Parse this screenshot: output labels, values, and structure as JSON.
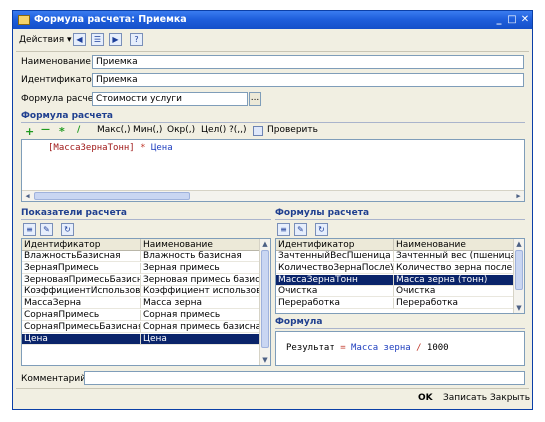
{
  "window": {
    "title": "Формула расчета: Приемка",
    "controls": [
      "_",
      "□",
      "✕"
    ]
  },
  "toolbar": {
    "actions_label": "Действия ▾",
    "icons": [
      "back-arrow-icon",
      "list-icon",
      "forward-icon",
      "help-icon"
    ],
    "help_glyph": "?"
  },
  "form": {
    "name_label": "Наименование:",
    "name_value": "Приемка",
    "id_label": "Идентификатор:",
    "id_value": "Приемка",
    "formula_label": "Формула расчета:",
    "formula_value": "Стоимости услуги",
    "ellipsis": "..."
  },
  "formula_section": {
    "title": "Формула расчета",
    "ops": [
      "+",
      "—",
      "*",
      "/"
    ],
    "funcs": [
      "Макс(,)",
      "Мин(,)",
      "Окр(,)",
      "Цел()",
      "?(,,)"
    ],
    "check_label": "Проверить",
    "expr_var": "[МассаЗернаТонн]",
    "expr_op": "*",
    "expr_var2": "Цена"
  },
  "indicators": {
    "title": "Показатели расчета",
    "columns": [
      "Идентификатор",
      "Наименование"
    ],
    "rows": [
      [
        "ВлажностьБазисная",
        "Влажность базисная"
      ],
      [
        "ЗернаяПримесь",
        "Зерная примесь"
      ],
      [
        "ЗерноваяПримесьБазисная",
        "Зерновая примесь базисная"
      ],
      [
        "КоэффициентИспользован...",
        "Коэффициент использован..."
      ],
      [
        "МассаЗерна",
        "Масса зерна"
      ],
      [
        "СорнаяПримесь",
        "Сорная примесь"
      ],
      [
        "СорнаяПримесьБазисная",
        "Сорная примесь базисная"
      ],
      [
        "Цена",
        "Цена"
      ]
    ],
    "selected_index": 7
  },
  "formulas": {
    "title": "Формулы расчета",
    "columns": [
      "Идентификатор",
      "Наименование"
    ],
    "rows": [
      [
        "ЗачтенныйВесПшеница",
        "Зачтенный вес (пшеница)"
      ],
      [
        "КоличествоЗернаПослеУсу...",
        "Количество зерна после усу..."
      ],
      [
        "МассаЗернаТонн",
        "Масса зерна (тонн)"
      ],
      [
        "Очистка",
        "Очистка"
      ],
      [
        "Переработка",
        "Переработка"
      ]
    ],
    "selected_index": 2
  },
  "formula_preview": {
    "title": "Формула",
    "result": "Результат",
    "eq": "=",
    "var": "Масса зерна",
    "op": "/",
    "num": "1000"
  },
  "comment": {
    "label": "Комментарий:",
    "value": ""
  },
  "buttons": {
    "ok": "OK",
    "save": "Записать",
    "close": "Закрыть"
  },
  "colors": {
    "title_bar": "#1f5fdc",
    "selection": "#0a246a",
    "section_text": "#1f3f8f",
    "code_var": "#9e1515",
    "code_op": "#c0392b",
    "code_keyword": "#1f3fbf"
  }
}
